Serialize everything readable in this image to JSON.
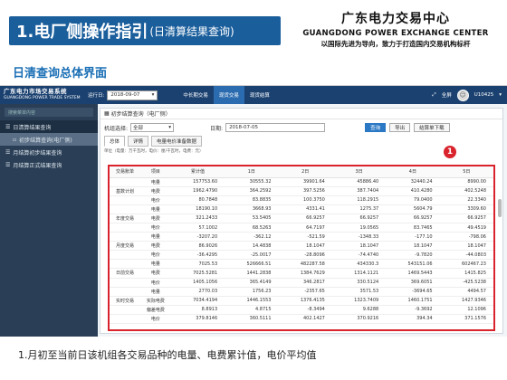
{
  "slide": {
    "title": "1.电厂侧操作指引",
    "subtitle": "(日清算结果查询)",
    "org_cn": "广东电力交易中心",
    "org_en": "GUANGDONG POWER EXCHANGE CENTER",
    "org_slogan": "以国际先进为导向，致力于打造国内交易机构标杆",
    "section_title": "日清查询总体界面",
    "footer_note": "1.月初至当前日该机组各交易品种的电量、电费累计值，电价平均值",
    "badge": "1"
  },
  "app": {
    "logo_cn": "广东电力市场交易系统",
    "logo_en": "GUANGDONG POWER TRADE SYSTEM",
    "run_day_label": "运行日:",
    "run_day_value": "2018-09-07",
    "nav": [
      "中长期交易",
      "现货交易",
      "现货结算"
    ],
    "fullscreen": "全屏",
    "user": "U10425"
  },
  "sidebar": {
    "search_placeholder": "搜索菜单内容",
    "items": [
      {
        "label": "日清算结果查询"
      },
      {
        "label": "初步结算查询(电厂侧)"
      },
      {
        "label": "月结算初步结果查询"
      },
      {
        "label": "月结算正式结果查询"
      }
    ]
  },
  "main": {
    "panel_title": "初步结算查询（电厂侧）",
    "unit_label": "机组选择:",
    "unit_value": "全部",
    "date_label": "日期:",
    "date_value": "2018-07-05",
    "btn_query": "查询",
    "btn_export": "导出",
    "btn_download": "结算单下载",
    "tabs": [
      "总体",
      "详情",
      "电量电价准备数据"
    ],
    "unit_note": "单位（电量：万千瓦时，电价：厘/千瓦时，电费：元）",
    "table": {
      "headers": [
        "交易账单",
        "项目",
        "累计值",
        "1日",
        "2日",
        "3日",
        "4日",
        "5日"
      ],
      "rows": [
        [
          "",
          "电量",
          "157753.60",
          "30555.32",
          "39901.64",
          "45886.40",
          "32440.24",
          "8990.00"
        ],
        [
          "基数计划",
          "电费",
          "1962.4790",
          "364.2592",
          "397.5256",
          "387.7404",
          "410.4280",
          "402.5248"
        ],
        [
          "",
          "电价",
          "80.7848",
          "83.8835",
          "100.3750",
          "118.2915",
          "79.0400",
          "22.3340"
        ],
        [
          "",
          "电量",
          "18190.10",
          "3668.93",
          "4331.41",
          "1275.37",
          "5604.79",
          "3309.60"
        ],
        [
          "年度交易",
          "电费",
          "321.2433",
          "53.5405",
          "66.9257",
          "66.9257",
          "66.9257",
          "66.9257"
        ],
        [
          "",
          "电价",
          "57.1002",
          "68.5263",
          "64.7197",
          "19.0565",
          "83.7465",
          "49.4519"
        ],
        [
          "",
          "电量",
          "-3207.20",
          "-362.12",
          "-521.59",
          "-1348.33",
          "-177.10",
          "-798.06"
        ],
        [
          "月度交易",
          "电费",
          "86.9026",
          "14.4838",
          "18.1047",
          "18.1047",
          "18.1047",
          "18.1047"
        ],
        [
          "",
          "电价",
          "-36.4295",
          "-25.0017",
          "-28.8096",
          "-74.4740",
          "-9.7820",
          "-44.0803"
        ],
        [
          "",
          "电量",
          "7025.53",
          "526666.51",
          "482287.58",
          "434330.3",
          "543151.06",
          "602467.23"
        ],
        [
          "日前交易",
          "电费",
          "7025.5281",
          "1441.2838",
          "1384.7629",
          "1314.1121",
          "1469.5443",
          "1415.825"
        ],
        [
          "",
          "电价",
          "1405.1056",
          "365.4149",
          "346.2817",
          "330.5124",
          "369.6051",
          "-425.5238"
        ],
        [
          "",
          "电量",
          "2770.03",
          "1756.23",
          "-2357.65",
          "3571.53",
          "-3694.65",
          "4494.57"
        ],
        [
          "实时交易",
          "实际电费",
          "7034.4194",
          "1446.1553",
          "1376.4135",
          "1323.7409",
          "1460.1751",
          "1427.9346"
        ],
        [
          "",
          "偏差电费",
          "8.8913",
          "4.8715",
          "-8.3494",
          "9.6288",
          "-9.3692",
          "12.1096"
        ],
        [
          "",
          "电价",
          "379.8146",
          "360.5111",
          "402.1427",
          "370.9216",
          "394.34",
          "371.1576"
        ]
      ]
    }
  }
}
